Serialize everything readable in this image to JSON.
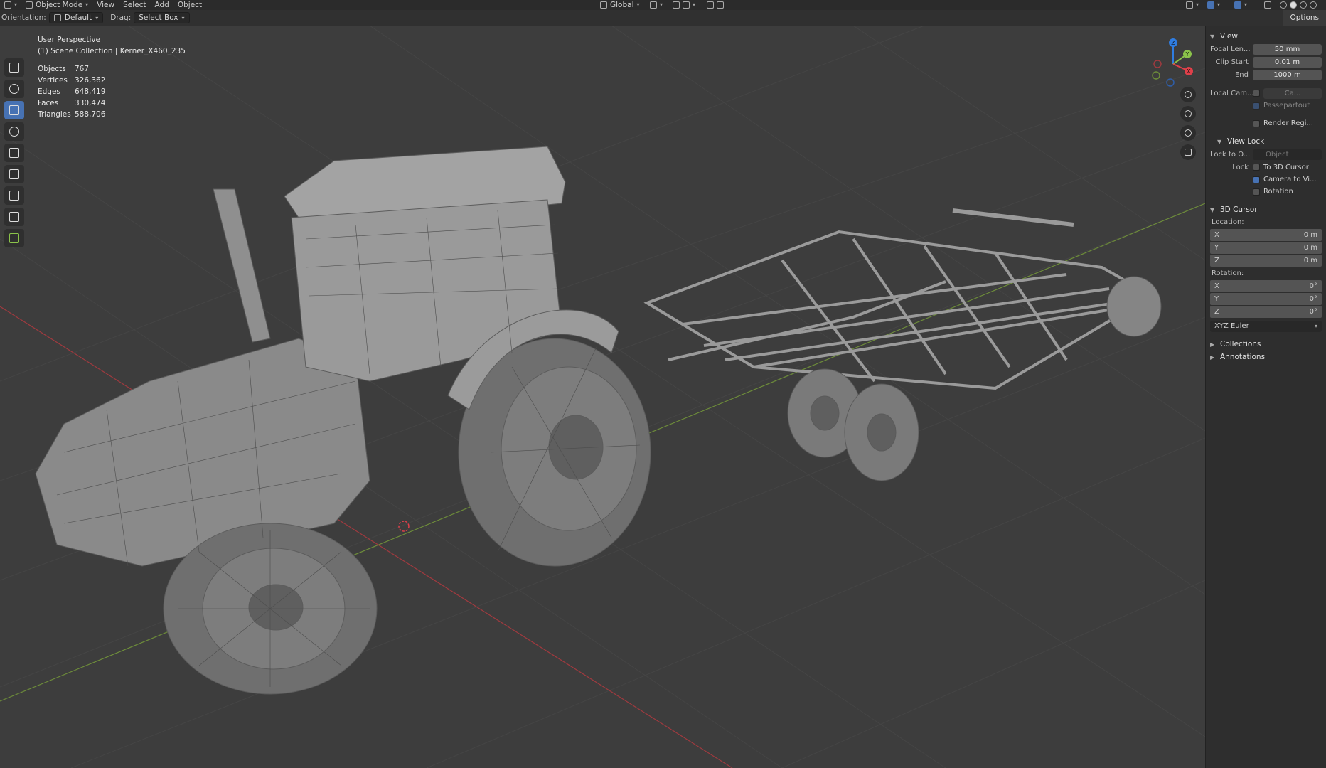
{
  "header": {
    "mode": "Object Mode",
    "menus": [
      "View",
      "Select",
      "Add",
      "Object"
    ],
    "transform_orientation": "Global"
  },
  "tool_settings": {
    "orientation_label": "Orientation:",
    "orientation_value": "Default",
    "drag_label": "Drag:",
    "drag_value": "Select Box",
    "options_label": "Options"
  },
  "viewport": {
    "view_name": "User Perspective",
    "collection": "(1) Scene Collection | Kerner_X460_235",
    "stats": [
      {
        "label": "Objects",
        "value": "767"
      },
      {
        "label": "Vertices",
        "value": "326,362"
      },
      {
        "label": "Edges",
        "value": "648,419"
      },
      {
        "label": "Faces",
        "value": "330,474"
      },
      {
        "label": "Triangles",
        "value": "588,706"
      }
    ],
    "gizmo_axes": [
      "Z",
      "Y",
      "X"
    ]
  },
  "sidebar": {
    "view_panel": {
      "title": "View",
      "focal_length_label": "Focal Len...",
      "focal_length_value": "50 mm",
      "clip_start_label": "Clip Start",
      "clip_start_value": "0.01 m",
      "end_label": "End",
      "end_value": "1000 m",
      "local_camera_label": "Local Cam...",
      "local_camera_value": "Ca...",
      "passepartout_label": "Passepartout",
      "render_region_label": "Render Regi..."
    },
    "view_lock_panel": {
      "title": "View Lock",
      "lock_to_object_label": "Lock to O...",
      "lock_to_object_placeholder": "Object",
      "lock_label": "Lock",
      "to_3d_cursor_label": "To 3D Cursor",
      "camera_to_view_label": "Camera to Vi...",
      "rotation_label": "Rotation"
    },
    "cursor_panel": {
      "title": "3D Cursor",
      "location_label": "Location:",
      "location": [
        {
          "axis": "X",
          "value": "0 m"
        },
        {
          "axis": "Y",
          "value": "0 m"
        },
        {
          "axis": "Z",
          "value": "0 m"
        }
      ],
      "rotation_label": "Rotation:",
      "rotation": [
        {
          "axis": "X",
          "value": "0°"
        },
        {
          "axis": "Y",
          "value": "0°"
        },
        {
          "axis": "Z",
          "value": "0°"
        }
      ],
      "rotation_mode": "XYZ Euler"
    },
    "collapsed_panels": [
      "Collections",
      "Annotations"
    ]
  },
  "colors": {
    "accent": "#4772b3",
    "axis_x": "#e0404a",
    "axis_y": "#8bc34a",
    "axis_z": "#2f7de1",
    "viewport_bg": "#3d3d3d"
  }
}
